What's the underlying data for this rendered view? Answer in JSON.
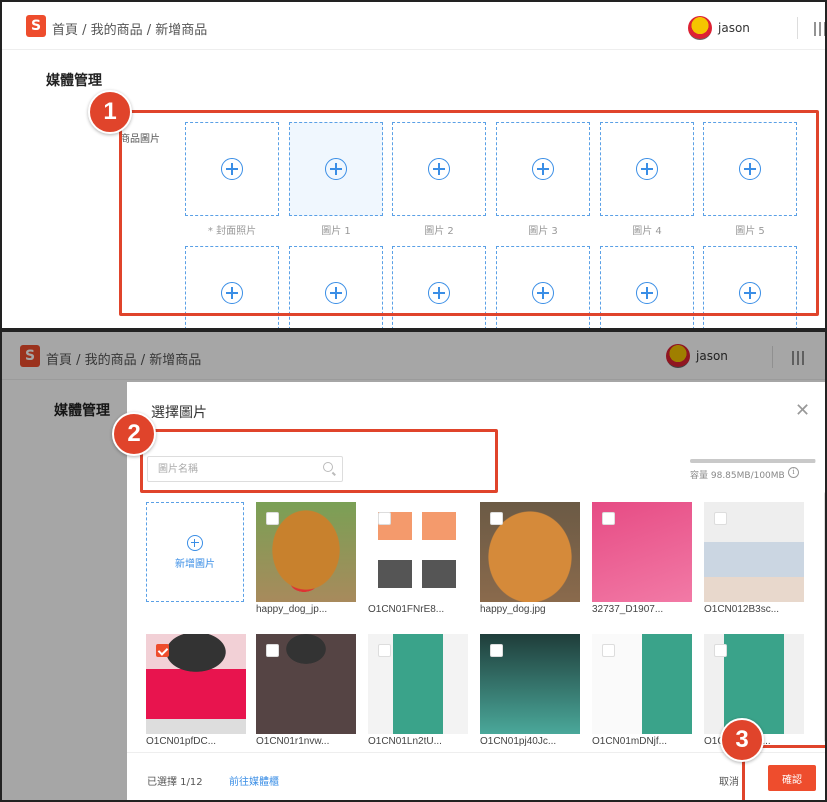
{
  "app": {
    "logo": "S",
    "user": "jason",
    "breadcrumb": "首頁 / 我的商品 / 新增商品"
  },
  "section": {
    "title": "媒體管理",
    "product_images_label": "商品圖片"
  },
  "slots": {
    "row1_labels": [
      "* 封面照片",
      "圖片 1",
      "圖片 2",
      "圖片 3",
      "圖片 4",
      "圖片 5"
    ]
  },
  "badges": [
    "1",
    "2",
    "3"
  ],
  "modal": {
    "title": "選擇圖片",
    "search_placeholder": "圖片名稱",
    "capacity": "容量 98.85MB/100MB",
    "capacity_used": 0.9885,
    "add_label": "新增圖片",
    "row1": [
      {
        "name": "happy_dog_jp...",
        "checked": false
      },
      {
        "name": "O1CN01FNrE8...",
        "checked": false
      },
      {
        "name": "happy_dog.jpg",
        "checked": false
      },
      {
        "name": "32737_D1907...",
        "checked": false
      },
      {
        "name": "O1CN012B3sc...",
        "checked": false
      }
    ],
    "row2": [
      {
        "name": "O1CN01pfDC...",
        "checked": true
      },
      {
        "name": "O1CN01r1nvw...",
        "checked": false
      },
      {
        "name": "O1CN01Ln2tU...",
        "checked": false
      },
      {
        "name": "O1CN01pj40Jc...",
        "checked": false
      },
      {
        "name": "O1CN01mDNjf...",
        "checked": false
      },
      {
        "name": "O1CN01...94...",
        "checked": false
      }
    ],
    "selected_text": "已選擇 1/12",
    "goto_text": "前往媒體櫃",
    "cancel": "取消",
    "confirm": "確認"
  },
  "colors": {
    "accent": "#ee4d2d",
    "callout": "#e0442b",
    "link": "#3a8ee6"
  }
}
